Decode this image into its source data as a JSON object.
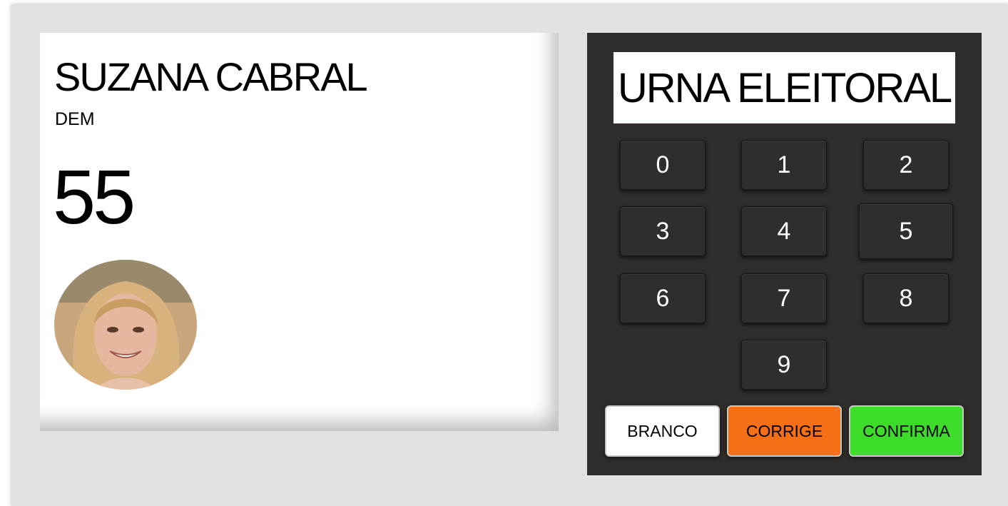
{
  "candidate": {
    "name": "SUZANA CABRAL",
    "party": "DEM",
    "number": "55"
  },
  "machine": {
    "title": "URNA ELEITORAL",
    "keys": [
      "0",
      "1",
      "2",
      "3",
      "4",
      "5",
      "6",
      "7",
      "8",
      "9"
    ],
    "actions": {
      "blank_label": "BRANCO",
      "correct_label": "CORRIGE",
      "confirm_label": "CONFIRMA"
    }
  },
  "colors": {
    "frame": "#e2e1df",
    "panel": "#312d2b",
    "blank_button": "#ffffff",
    "correct_button": "#f46f16",
    "confirm_button": "#3ddc2a"
  }
}
